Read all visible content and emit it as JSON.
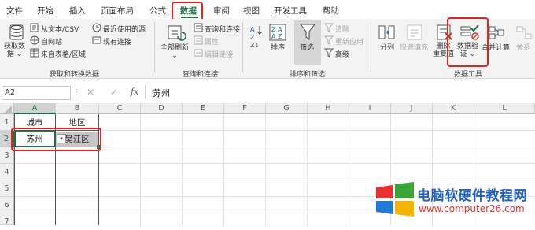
{
  "tabs": [
    "文件",
    "开始",
    "插入",
    "页面布局",
    "公式",
    "数据",
    "审阅",
    "视图",
    "开发工具",
    "帮助"
  ],
  "ribbon": {
    "get_data": {
      "big_label_1": "获取数",
      "big_label_2": "据",
      "from_text_csv": "从文本/CSV",
      "from_web": "自网站",
      "from_table": "来自表格/区域",
      "recent_sources": "最近使用的源",
      "existing_conn": "现有连接",
      "group": "获取和转换数据"
    },
    "queries": {
      "refresh_1": "全部刷新",
      "queries_conn": "查询和连接",
      "properties": "属性",
      "edit_links": "编辑链接",
      "group": "查询和连接"
    },
    "sort_filter": {
      "sort": "排序",
      "filter": "筛选",
      "clear": "清除",
      "reapply": "重新应用",
      "advanced": "高级",
      "group": "排序和筛选"
    },
    "data_tools": {
      "text_to_columns": "分列",
      "flash_fill": "快速填充",
      "remove_dup_1": "删除",
      "remove_dup_2": "重复值",
      "validation_1": "数据验",
      "validation_2": "证",
      "consolidate": "合并计算",
      "relationships": "关系",
      "group": "数据工具"
    }
  },
  "formula_bar": {
    "name_box": "A2",
    "fx": "fx",
    "value": "苏州"
  },
  "columns": [
    "A",
    "B",
    "C",
    "D",
    "E",
    "F",
    "G",
    "H",
    "I",
    "J",
    "K",
    "L"
  ],
  "rows": [
    "1",
    "2",
    "3",
    "4",
    "5",
    "6",
    "7"
  ],
  "cells": {
    "A1": "城市",
    "B1": "地区",
    "A2": "苏州",
    "B2": "吴江区"
  },
  "watermark": {
    "title": "电脑软硬件教程网",
    "url": "www.computer26.com"
  },
  "colors": {
    "accent": "#1e7145",
    "highlight": "#e8201c"
  }
}
